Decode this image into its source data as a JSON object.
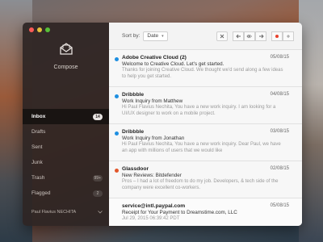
{
  "colors": {
    "close": "#fc5b57",
    "minimize": "#e5bf3c",
    "zoom": "#57c038",
    "unread_blue": "#1e8fe1",
    "unread_orange": "#e2562b",
    "flag_red": "#e8412c"
  },
  "sidebar": {
    "compose_label": "Compose",
    "items": [
      {
        "label": "Inbox",
        "count": "14",
        "active": true
      },
      {
        "label": "Drafts",
        "count": ""
      },
      {
        "label": "Sent",
        "count": ""
      },
      {
        "label": "Junk",
        "count": ""
      },
      {
        "label": "Trash",
        "count": "99+"
      },
      {
        "label": "Flagged",
        "count": "2"
      }
    ],
    "account_name": "Paul Flavius NECHITA"
  },
  "toolbar": {
    "sort_label": "Sort by:",
    "sort_value": "Date",
    "icons": [
      "close-icon",
      "reply-icon",
      "reply-all-icon",
      "forward-icon",
      "flag-icon",
      "plus-icon"
    ]
  },
  "messages": [
    {
      "sender": "Adobe Creative Cloud (2)",
      "date": "05/08/15",
      "subject": "Welcome to Creative Cloud. Let's get started.",
      "preview": "Thanks for joining Creative Cloud. We thought we'd send along a few ideas to help you get started.",
      "dot": "#1e8fe1"
    },
    {
      "sender": "Dribbble",
      "date": "04/08/15",
      "subject": "Work Inquiry from Matthew",
      "preview": "Hi Paul Flavius Nechita, You have a new work inquiry. I am looking for a UI/UX designer to work on a mobile project.",
      "dot": "#1e8fe1"
    },
    {
      "sender": "Dribbble",
      "date": "03/08/15",
      "subject": "Work Inquiry from Jonathan",
      "preview": "Hi Paul Flavius Nechita, You have a new work inquiry. Dear Paul, we have an app with millions of users that we would like",
      "dot": "#1e8fe1"
    },
    {
      "sender": "Glassdoor",
      "date": "02/08/15",
      "subject": "New Reviews: Bitdefender",
      "preview": "Pros – I had a lot of freedom to do my job. Developers, & tech side of the company were excellent co-workers.",
      "dot": "#e2562b"
    },
    {
      "sender": "service@intl.paypal.com",
      "date": "05/08/15",
      "subject": "Receipt for Your Payment to Dreamstime.com, LLC",
      "preview": "Jul 29, 2015 06:39:42 PDT",
      "dot": ""
    }
  ]
}
